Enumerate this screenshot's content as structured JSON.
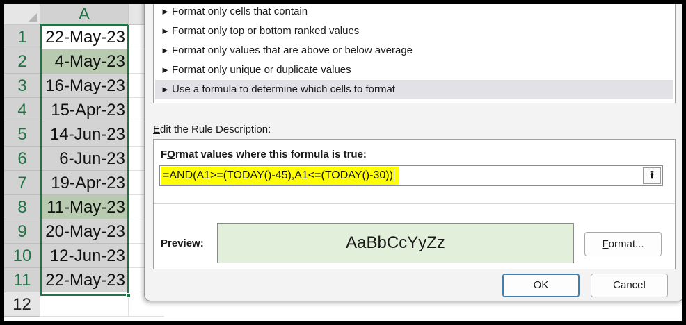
{
  "sheet": {
    "column_header": "A",
    "rows": [
      {
        "num": "1",
        "value": "22-May-23",
        "style": "first"
      },
      {
        "num": "2",
        "value": "4-May-23",
        "style": "hl"
      },
      {
        "num": "3",
        "value": "16-May-23",
        "style": "normal"
      },
      {
        "num": "4",
        "value": "15-Apr-23",
        "style": "normal"
      },
      {
        "num": "5",
        "value": "14-Jun-23",
        "style": "normal"
      },
      {
        "num": "6",
        "value": "6-Jun-23",
        "style": "normal"
      },
      {
        "num": "7",
        "value": "19-Apr-23",
        "style": "normal"
      },
      {
        "num": "8",
        "value": "11-May-23",
        "style": "hl"
      },
      {
        "num": "9",
        "value": "20-May-23",
        "style": "normal"
      },
      {
        "num": "10",
        "value": "12-Jun-23",
        "style": "normal"
      },
      {
        "num": "11",
        "value": "22-May-23",
        "style": "normal"
      },
      {
        "num": "12",
        "value": "",
        "style": "blank"
      }
    ],
    "colors": {
      "selection": "#217346",
      "highlight_fill": "#b8cbb0",
      "selected_fill": "#d3d3d3"
    }
  },
  "dialog": {
    "rule_types": [
      {
        "label": "Format only cells that contain",
        "selected": false
      },
      {
        "label": "Format only top or bottom ranked values",
        "selected": false
      },
      {
        "label": "Format only values that are above or below average",
        "selected": false
      },
      {
        "label": "Format only unique or duplicate values",
        "selected": false
      },
      {
        "label": "Use a formula to determine which cells to format",
        "selected": true
      }
    ],
    "rule_arrow": "►",
    "description_label_key": "E",
    "description_label_rest": "dit the Rule Description:",
    "formula_label_key": "O",
    "formula_label_pre": "F",
    "formula_label_rest": "rmat values where this formula is true:",
    "formula_value": "=AND(A1>=(TODAY()-45),A1<=(TODAY()-30))",
    "collapse_icon": "⭱",
    "preview_label": "Preview:",
    "preview_sample": "AaBbCcYyZz",
    "format_button_key": "F",
    "format_button_rest": "ormat...",
    "ok_label": "OK",
    "cancel_label": "Cancel",
    "colors": {
      "formula_highlight": "#ffff00",
      "preview_fill": "#e2efda",
      "ok_border": "#3c7fb1"
    }
  }
}
